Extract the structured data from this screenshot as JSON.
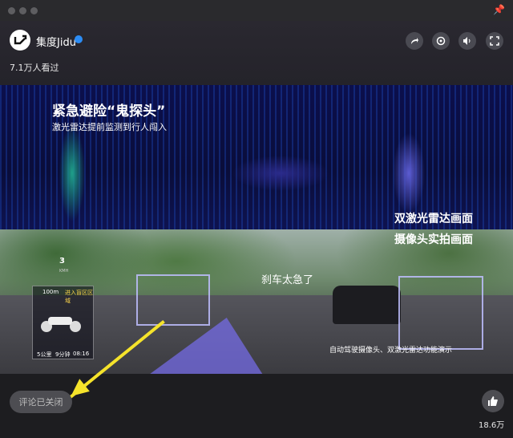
{
  "window": {
    "pin_icon": "pin-icon"
  },
  "header": {
    "author": "集度Jidu",
    "views": "7.1万人看过",
    "actions": [
      "share-icon",
      "settings-icon",
      "volume-icon",
      "fullscreen-icon"
    ]
  },
  "video": {
    "title": "紧急避险“鬼探头”",
    "subtitle": "激光雷达提前监测到行人闯入",
    "label_lidar": "双激光雷达画面",
    "label_camera": "摄像头实拍画面",
    "brake_text": "刹车太急了",
    "caption": "自动驾驶摄像头、双激光雷达功能演示",
    "hud": {
      "speed": "3",
      "speed_unit": "KMH",
      "distance": "100m",
      "tag": "进入盲区区域",
      "bottom_left": "5公里",
      "bottom_mid": "9分钟",
      "time": "08:16"
    }
  },
  "footer": {
    "comment_status": "评论已关闭",
    "like_count": "18.6万"
  }
}
